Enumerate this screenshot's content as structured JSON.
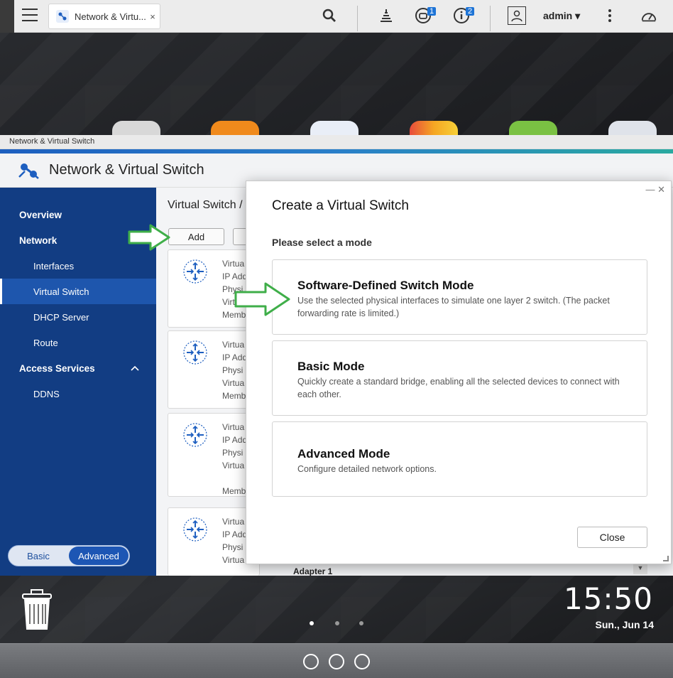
{
  "taskbar": {
    "tab_label": "Network & Virtu...",
    "tab_close": "×",
    "notification_count": "1",
    "info_count": "2",
    "user": "admin",
    "user_caret": "▾"
  },
  "window": {
    "caption": "Network & Virtual Switch",
    "app_title": "Network & Virtual Switch"
  },
  "sidebar": {
    "items": [
      {
        "label": "Overview"
      },
      {
        "label": "Network"
      },
      {
        "label": "Interfaces"
      },
      {
        "label": "Virtual Switch"
      },
      {
        "label": "DHCP Server"
      },
      {
        "label": "Route"
      },
      {
        "label": "Access Services"
      },
      {
        "label": "DDNS"
      }
    ],
    "mode_basic": "Basic",
    "mode_advanced": "Advanced"
  },
  "main": {
    "breadcrumb": "Virtual Switch /",
    "add_button": "Add",
    "cards": [
      {
        "lines": [
          "Virtua",
          "IP Add",
          "Physi",
          "Virtu",
          "Memb"
        ]
      },
      {
        "lines": [
          "Virtua",
          "IP Add",
          "Physi",
          "Virtua",
          "Memb"
        ]
      },
      {
        "lines": [
          "Virtua",
          "IP Add",
          "Physi",
          "Virtua",
          "",
          "Memb"
        ]
      },
      {
        "lines": [
          "Virtua",
          "IP Add",
          "Physi",
          "Virtua"
        ]
      }
    ],
    "adapter_label": "Adapter 1"
  },
  "modal": {
    "title": "Create a Virtual Switch",
    "subtitle": "Please select a mode",
    "modes": [
      {
        "name": "Software-Defined Switch Mode",
        "desc": "Use the selected physical interfaces to simulate one layer 2 switch. (The packet forwarding rate is limited.)"
      },
      {
        "name": "Basic Mode",
        "desc": "Quickly create a standard bridge, enabling all the selected devices to connect with each other."
      },
      {
        "name": "Advanced Mode",
        "desc": "Configure detailed network options."
      }
    ],
    "close_label": "Close",
    "window_controls": "— ✕"
  },
  "desktop": {
    "time": "15:50",
    "date": "Sun., Jun 14"
  },
  "colors": {
    "sidebar_bg": "#123d83",
    "sidebar_active": "#1e56ad",
    "arrow_green": "#3fae49",
    "badge_blue": "#1e74d6"
  }
}
